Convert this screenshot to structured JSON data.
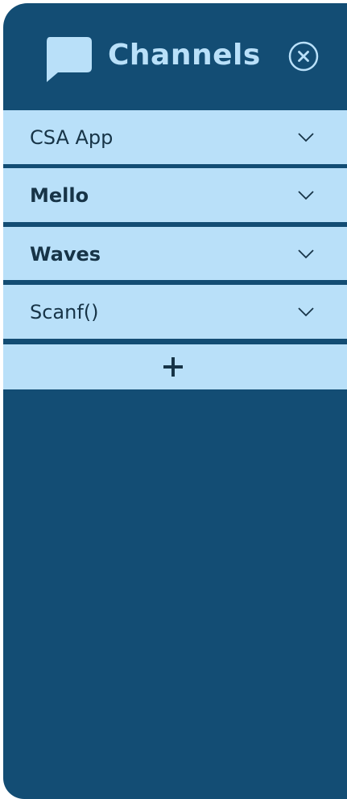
{
  "header": {
    "title": "Channels",
    "icon": "chat-bubble-icon",
    "close_icon": "close-circle-icon"
  },
  "channels": [
    {
      "label": "CSA App",
      "bold": false
    },
    {
      "label": "Mello",
      "bold": true
    },
    {
      "label": "Waves",
      "bold": true
    },
    {
      "label": "Scanf()",
      "bold": false
    }
  ],
  "add_button": {
    "icon": "plus-icon"
  },
  "colors": {
    "panel_background": "#134d74",
    "row_background": "#b9e0f9",
    "row_text": "#173447",
    "title_text": "#b9e0f9"
  }
}
